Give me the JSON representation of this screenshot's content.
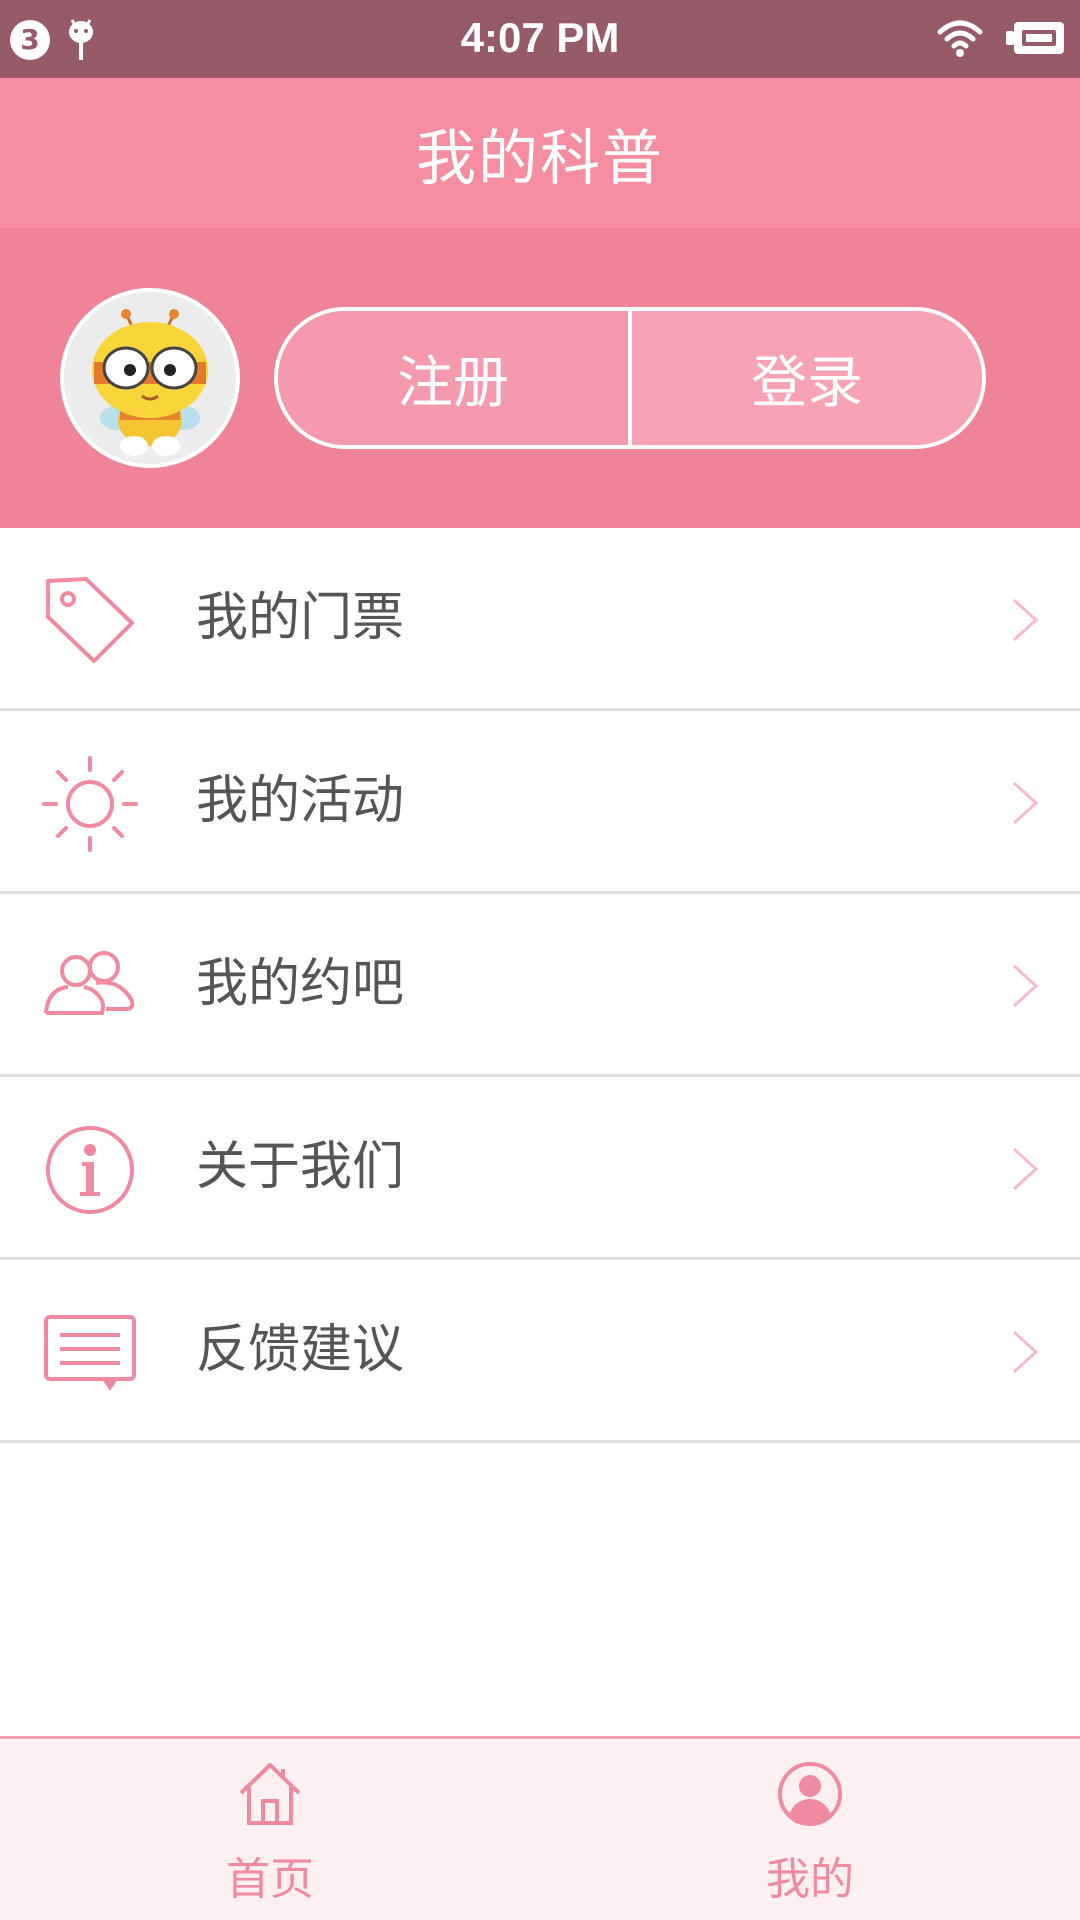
{
  "status_bar": {
    "notification_count": "3",
    "time": "4:07 PM",
    "icons": [
      "android-debug-icon",
      "wifi-icon",
      "battery-icon"
    ]
  },
  "header": {
    "title": "我的科普"
  },
  "profile": {
    "avatar": "bee-avatar",
    "register_label": "注册",
    "login_label": "登录"
  },
  "menu": {
    "items": [
      {
        "label": "我的门票",
        "icon": "ticket-tag-icon"
      },
      {
        "label": "我的活动",
        "icon": "sun-icon"
      },
      {
        "label": "我的约吧",
        "icon": "group-icon"
      },
      {
        "label": "关于我们",
        "icon": "info-icon"
      },
      {
        "label": "反馈建议",
        "icon": "feedback-icon"
      }
    ]
  },
  "tab_bar": {
    "tabs": [
      {
        "label": "首页",
        "icon": "home-icon"
      },
      {
        "label": "我的",
        "icon": "user-icon"
      }
    ]
  },
  "colors": {
    "status_bar": "#965a68",
    "title_bar": "#f78da1",
    "profile_bg": "#ef8397",
    "accent": "#f08aa0",
    "tab_bar_bg": "#fdf0f2"
  }
}
